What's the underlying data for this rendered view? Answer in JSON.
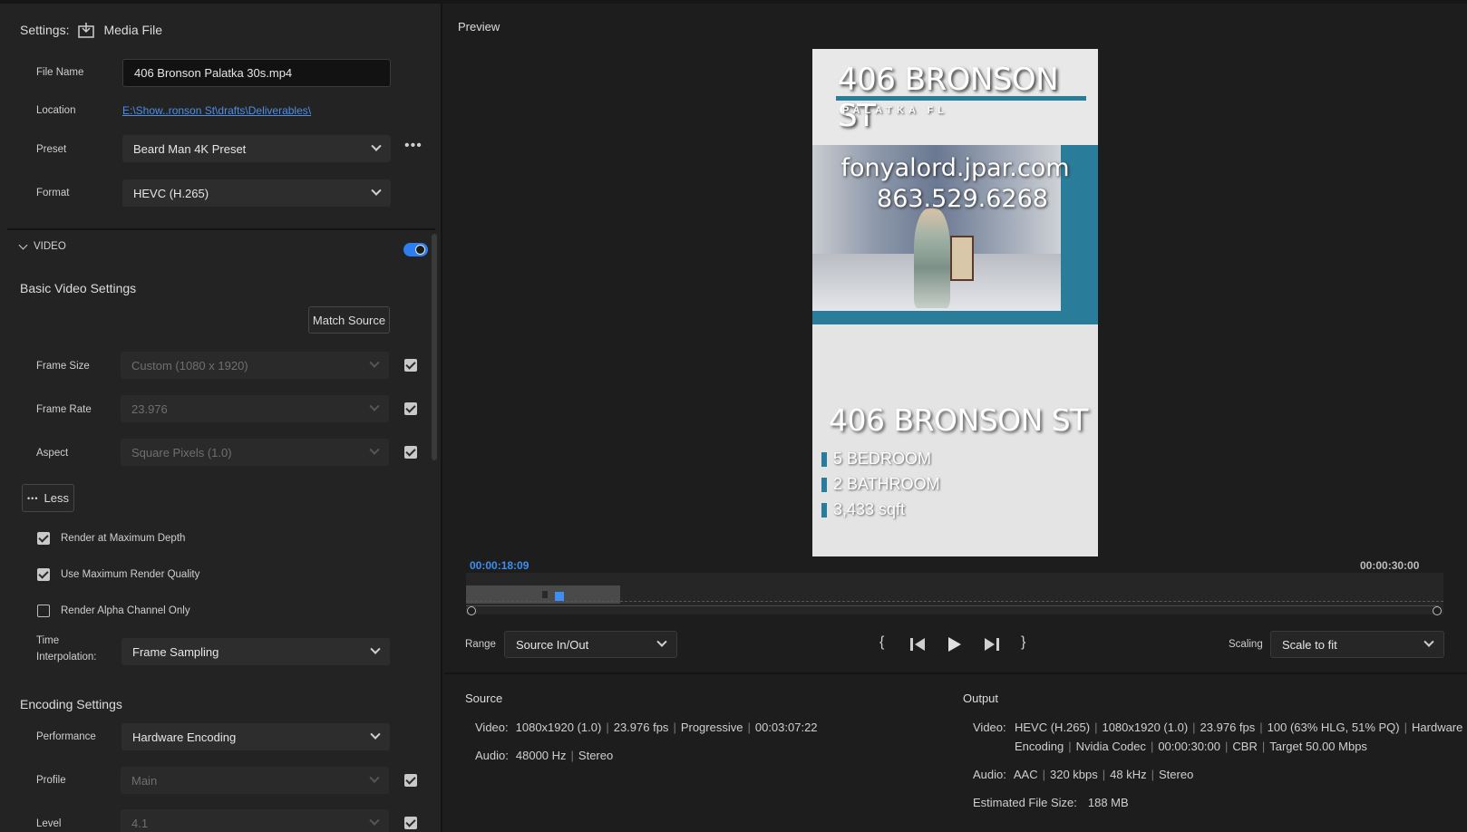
{
  "settings": {
    "label": "Settings:",
    "media_label": "Media File",
    "file_name_label": "File Name",
    "file_name_value": "406 Bronson Palatka 30s.mp4",
    "location_label": "Location",
    "location_value": "E:\\Show..ronson St\\drafts\\Deliverables\\",
    "preset_label": "Preset",
    "preset_value": "Beard Man 4K Preset",
    "format_label": "Format",
    "format_value": "HEVC (H.265)"
  },
  "video": {
    "section_label": "VIDEO",
    "toggle_on": true,
    "basic_title": "Basic Video Settings",
    "match_source": "Match Source",
    "frame_size_label": "Frame Size",
    "frame_size_value": "Custom (1080 x 1920)",
    "frame_rate_label": "Frame Rate",
    "frame_rate_value": "23.976",
    "aspect_label": "Aspect",
    "aspect_value": "Square Pixels (1.0)",
    "less_label": "Less",
    "render_max_depth": "Render at Maximum Depth",
    "use_max_quality": "Use Maximum Render Quality",
    "render_alpha": "Render Alpha Channel Only",
    "time_interp_label_1": "Time",
    "time_interp_label_2": "Interpolation:",
    "time_interp_value": "Frame Sampling",
    "encoding_title": "Encoding Settings",
    "performance_label": "Performance",
    "performance_value": "Hardware Encoding",
    "profile_label": "Profile",
    "profile_value": "Main",
    "level_label": "Level",
    "level_value": "4.1"
  },
  "preview": {
    "title": "Preview",
    "overlay": {
      "top_title": "406 BRONSON ST",
      "top_sub": "PALATKA FL",
      "website": "fonyalord.jpar.com",
      "phone": "863.529.6268",
      "bottom_title": "406 BRONSON ST",
      "bullets": [
        "5 BEDROOM",
        "2 BATHROOM",
        "3,433 sqft"
      ]
    },
    "current_time": "00:00:18:09",
    "end_time": "00:00:30:00",
    "range_label": "Range",
    "range_value": "Source In/Out",
    "scaling_label": "Scaling",
    "scaling_value": "Scale to fit"
  },
  "source": {
    "title": "Source",
    "video_label": "Video:",
    "video_parts": [
      "1080x1920 (1.0)",
      "23.976 fps",
      "Progressive",
      "00:03:07:22"
    ],
    "audio_label": "Audio:",
    "audio_parts": [
      "48000 Hz",
      "Stereo"
    ]
  },
  "output": {
    "title": "Output",
    "video_label": "Video:",
    "video_line1": [
      "HEVC (H.265)",
      "1080x1920 (1.0)",
      "23.976 fps",
      "100 (63% HLG, 51% PQ)",
      "Hardware"
    ],
    "video_line2": [
      "Encoding",
      "Nvidia Codec",
      "00:00:30:00",
      "CBR",
      "Target 50.00 Mbps"
    ],
    "audio_label": "Audio:",
    "audio_parts": [
      "AAC",
      "320 kbps",
      "48 kHz",
      "Stereo"
    ],
    "file_size_label": "Estimated File Size:",
    "file_size_value": "188 MB"
  },
  "colors": {
    "accent": "#2d7ff0",
    "teal": "#2a7d9a",
    "panel": "#232323",
    "background": "#1d1d1d"
  }
}
